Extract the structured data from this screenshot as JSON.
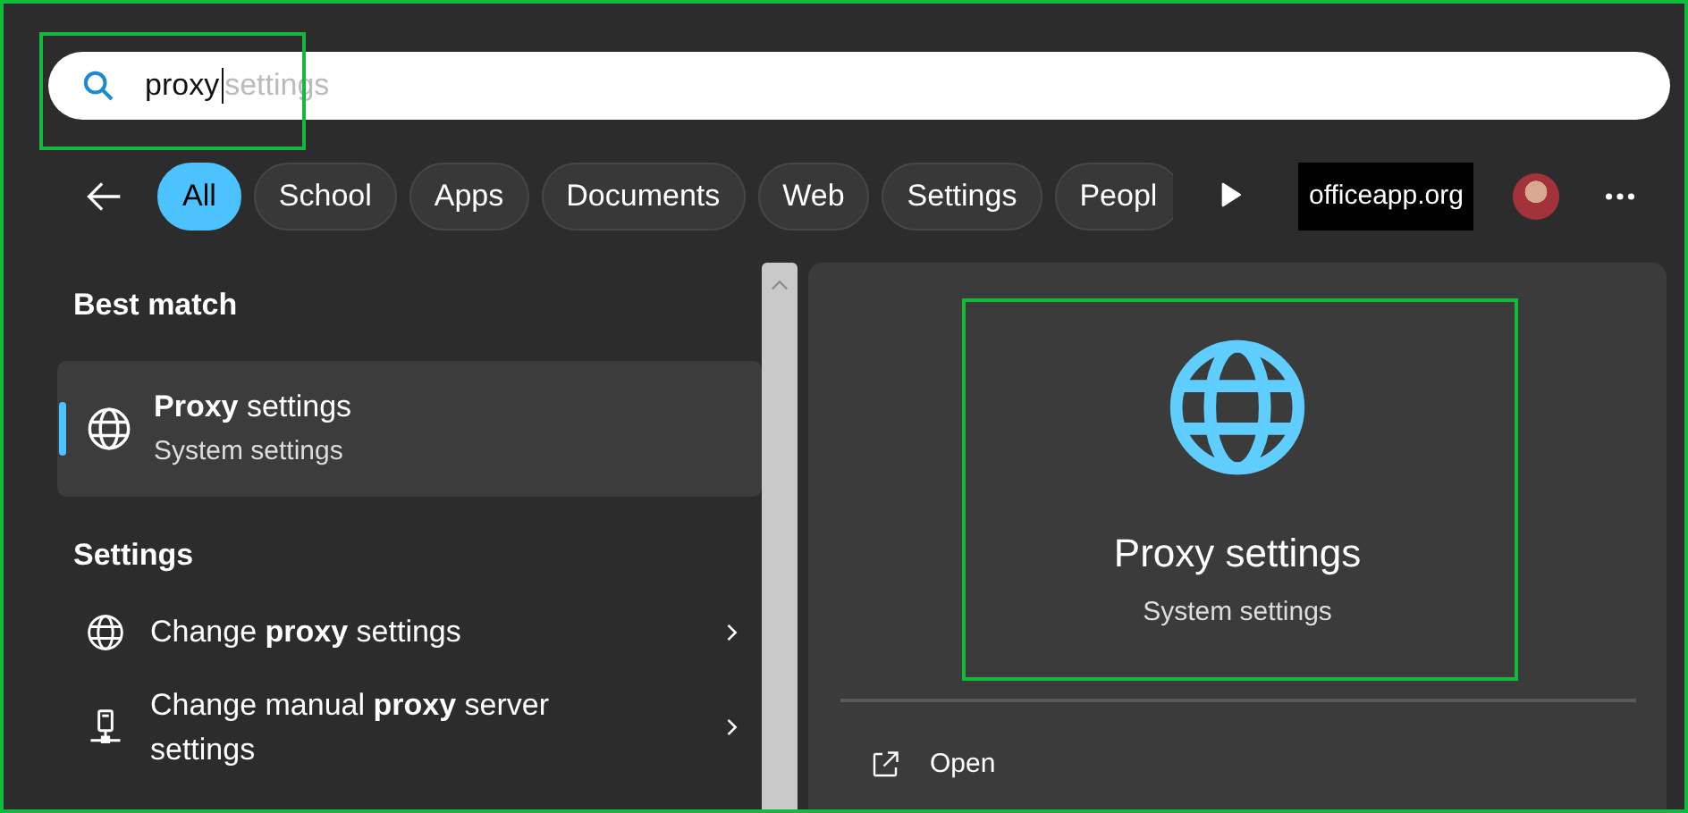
{
  "search": {
    "value": "proxy",
    "suggestion": "settings"
  },
  "filters": [
    {
      "label": "All",
      "selected": true
    },
    {
      "label": "School",
      "selected": false
    },
    {
      "label": "Apps",
      "selected": false
    },
    {
      "label": "Documents",
      "selected": false
    },
    {
      "label": "Web",
      "selected": false
    },
    {
      "label": "Settings",
      "selected": false
    },
    {
      "label": "Peopl",
      "selected": false
    }
  ],
  "org_badge": "officeapp.org",
  "best_match": {
    "heading": "Best match",
    "item": {
      "title": "**Proxy** settings",
      "subtitle": "System settings",
      "selected": true
    }
  },
  "settings": {
    "heading": "Settings",
    "items": [
      {
        "label": "Change **proxy** settings",
        "kind": "globe"
      },
      {
        "label": "Change manual **proxy** server settings",
        "kind": "network"
      }
    ]
  },
  "preview": {
    "title": "Proxy settings",
    "subtitle": "System settings",
    "actions": [
      {
        "label": "Open",
        "kind": "open"
      }
    ]
  }
}
